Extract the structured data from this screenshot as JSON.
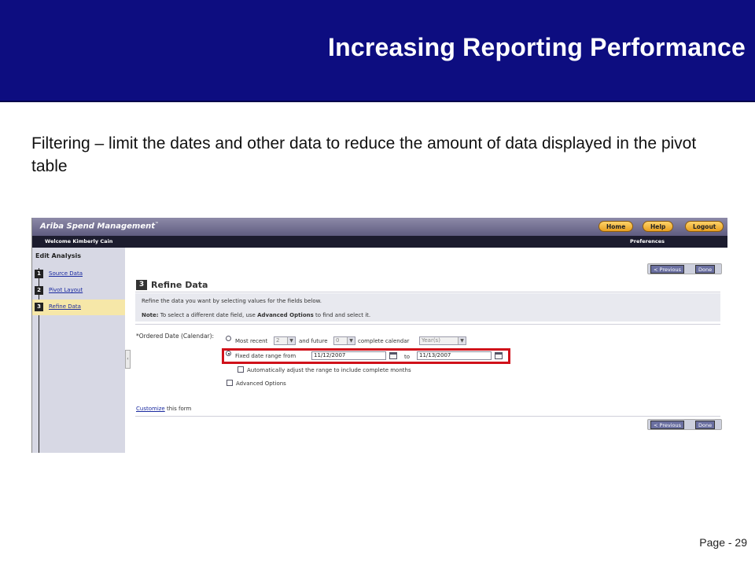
{
  "slide": {
    "title": "Increasing Reporting Performance",
    "intro": "Filtering – limit the dates and other data to reduce the amount of data displayed in the pivot table",
    "page_number": "Page - 29"
  },
  "app": {
    "brand": "Ariba  Spend Management",
    "brand_tm": "™",
    "nav": {
      "home": "Home",
      "help": "Help",
      "logout": "Logout"
    },
    "welcome": "Welcome Kimberly Cain",
    "preferences": "Preferences"
  },
  "sidebar": {
    "title": "Edit Analysis",
    "steps": [
      {
        "num": "1",
        "label": "Source Data"
      },
      {
        "num": "2",
        "label": "Pivot Layout"
      },
      {
        "num": "3",
        "label": "Refine Data"
      }
    ]
  },
  "buttons": {
    "previous": "< Previous",
    "done": "Done"
  },
  "section": {
    "num": "3",
    "title": "Refine Data",
    "info_line1": "Refine the data you want by selecting values for the fields below.",
    "note_label": "Note:",
    "note_pre": "To select a different date field, use",
    "note_link": "Advanced Options",
    "note_post": "to find and select it."
  },
  "form": {
    "field_label": "*Ordered Date (Calendar):",
    "most_recent": "Most recent",
    "most_recent_value": "2",
    "and_future": "and future",
    "future_value": "0",
    "complete_calendar": "complete calendar",
    "period_value": "Year(s)",
    "fixed_range": "Fixed date range from",
    "from_date": "11/12/2007",
    "to_label": "to",
    "to_date": "11/13/2007",
    "auto_adjust": "Automatically adjust the range to include complete months",
    "advanced": "Advanced Options",
    "customize_link": "Customize",
    "customize_rest": "this form"
  },
  "colors": {
    "banner": "#0d0d80",
    "highlight": "#d0111a",
    "nav_button": "#f0b030"
  }
}
